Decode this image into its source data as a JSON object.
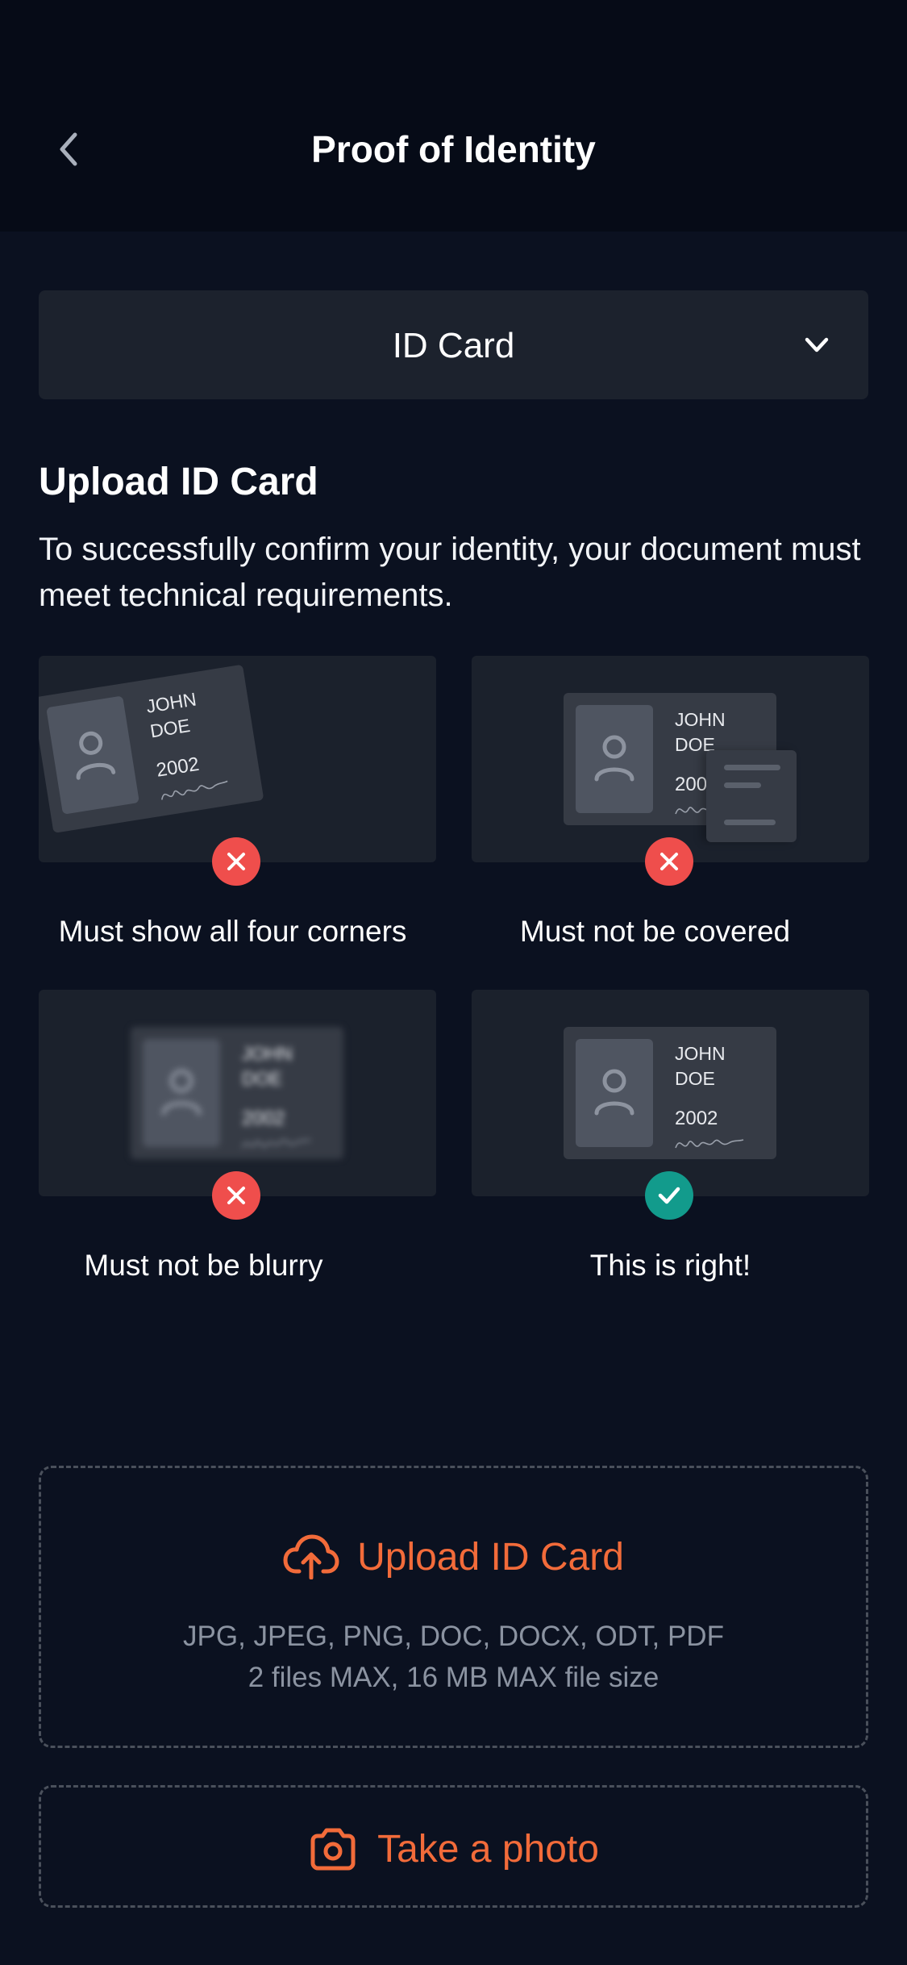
{
  "header": {
    "title": "Proof of Identity",
    "back_icon": "chevron-left-icon"
  },
  "document_select": {
    "value": "ID Card",
    "icon": "chevron-down-icon"
  },
  "intro": {
    "title": "Upload ID Card",
    "description": "To successfully confirm your identity, your document must meet technical requirements."
  },
  "sample_card": {
    "name_line1": "JOHN",
    "name_line2": "DOE",
    "year": "2002"
  },
  "examples": [
    {
      "caption": "Must show all four corners",
      "status": "invalid",
      "status_icon": "x-icon"
    },
    {
      "caption": "Must not be covered",
      "status": "invalid",
      "status_icon": "x-icon"
    },
    {
      "caption": "Must not be blurry",
      "status": "invalid",
      "status_icon": "x-icon"
    },
    {
      "caption": "This is right!",
      "status": "valid",
      "status_icon": "check-icon"
    }
  ],
  "upload": {
    "label": "Upload ID Card",
    "icon": "cloud-upload-icon",
    "formats": "JPG, JPEG, PNG, DOC, DOCX, ODT, PDF",
    "limits": "2 files MAX, 16 MB MAX file size"
  },
  "photo": {
    "label": "Take a photo",
    "icon": "camera-icon"
  },
  "colors": {
    "background": "#0b1120",
    "header_background": "#060b17",
    "tile_background": "#1b212c",
    "accent": "#f26b3a",
    "error": "#ef4e4c",
    "success": "#129b8c",
    "muted_text": "#8b93a1"
  }
}
